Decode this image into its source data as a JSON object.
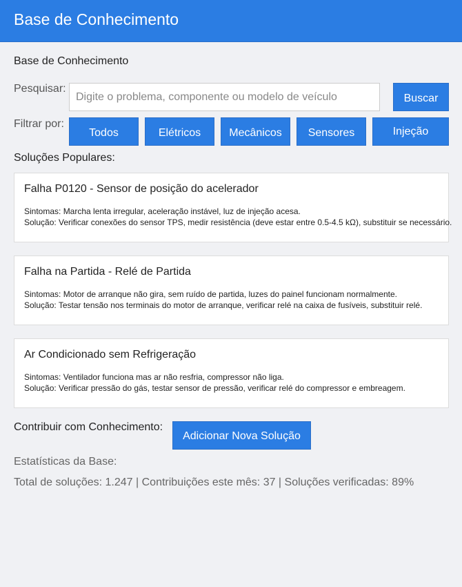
{
  "header": {
    "title": "Base de Conhecimento"
  },
  "main": {
    "section_title": "Base de Conhecimento",
    "search": {
      "label": "Pesquisar:",
      "placeholder": "Digite o problema, componente ou modelo de veículo",
      "value": "",
      "button": "Buscar"
    },
    "filters": {
      "label": "Filtrar por:",
      "items": [
        "Todos",
        "Elétricos",
        "Mecânicos",
        "Sensores",
        "Injeção"
      ]
    },
    "popular": {
      "title": "Soluções Populares:",
      "cards": [
        {
          "title": "Falha P0120 - Sensor de posição do acelerador",
          "symptoms": "Sintomas: Marcha lenta irregular, aceleração instável, luz de injeção acesa.",
          "solution": "Solução: Verificar conexões do sensor TPS, medir resistência (deve estar entre 0.5-4.5 kΩ), substituir se necessário."
        },
        {
          "title": "Falha na Partida - Relé de Partida",
          "symptoms": "Sintomas: Motor de arranque não gira, sem ruído de partida, luzes do painel funcionam normalmente.",
          "solution": "Solução: Testar tensão nos terminais do motor de arranque, verificar relé na caixa de fusíveis, substituir relé."
        },
        {
          "title": "Ar Condicionado sem Refrigeração",
          "symptoms": "Sintomas: Ventilador funciona mas ar não resfria, compressor não liga.",
          "solution": "Solução: Verificar pressão do gás, testar sensor de pressão, verificar relé do compressor e embreagem."
        }
      ]
    },
    "contribute": {
      "label": "Contribuir com Conhecimento:",
      "button": "Adicionar Nova Solução"
    },
    "stats": {
      "title": "Estatísticas da Base:",
      "line": "Total de soluções: 1.247 | Contribuições este mês: 37 | Soluções verificadas: 89%"
    }
  },
  "colors": {
    "primary": "#2b7de3",
    "background": "#f0f1f4",
    "card": "#ffffff"
  }
}
